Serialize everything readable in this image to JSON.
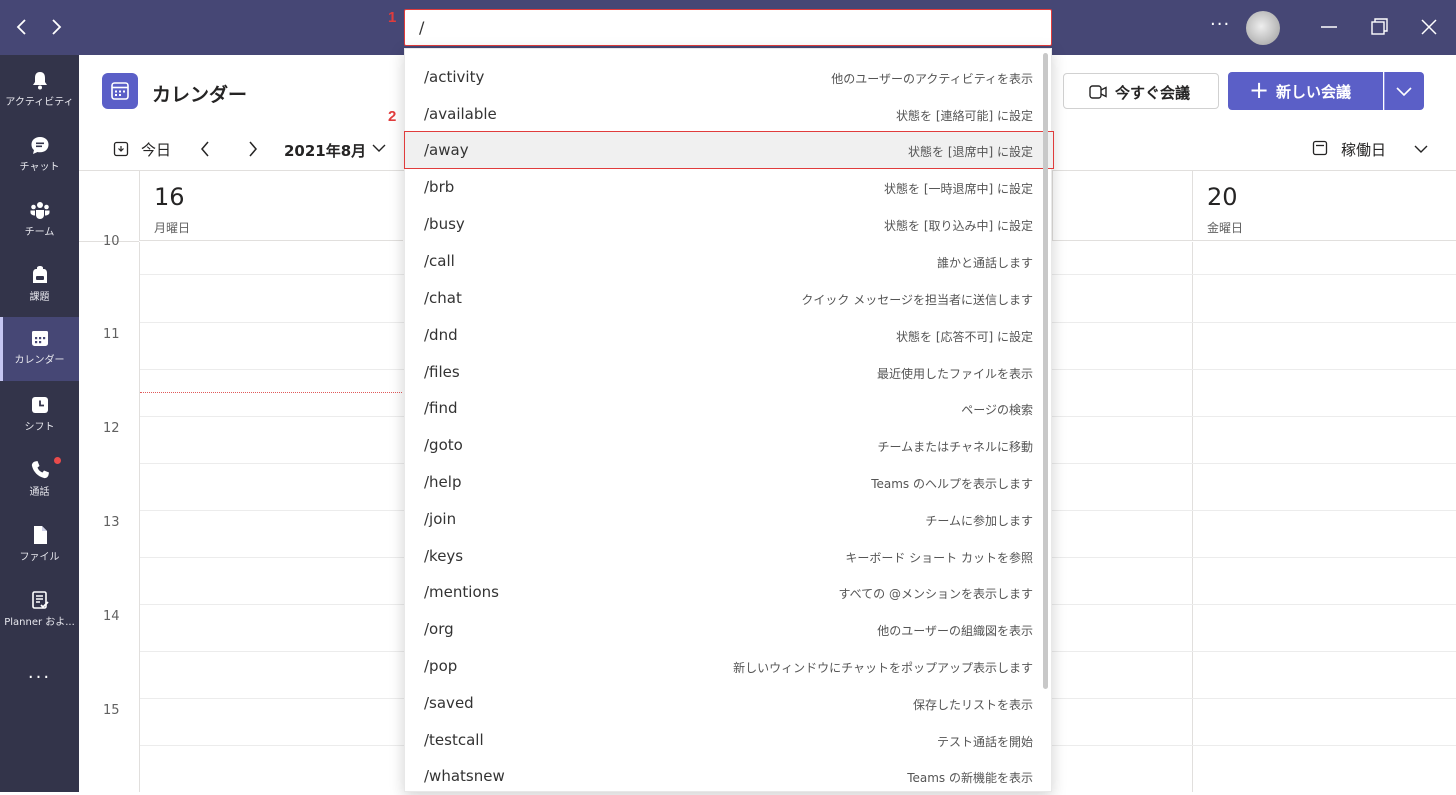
{
  "titlebar": {
    "back_icon": "chevron-left-icon",
    "forward_icon": "chevron-right-icon",
    "search_value": "/",
    "more_label": "···",
    "annotation_1": "1",
    "annotation_2": "2"
  },
  "rail": {
    "items": [
      {
        "label": "アクティビティ",
        "icon": "bell-icon"
      },
      {
        "label": "チャット",
        "icon": "chat-icon"
      },
      {
        "label": "チーム",
        "icon": "teams-icon"
      },
      {
        "label": "課題",
        "icon": "backpack-icon"
      },
      {
        "label": "カレンダー",
        "icon": "calendar-icon"
      },
      {
        "label": "シフト",
        "icon": "clock-icon"
      },
      {
        "label": "通話",
        "icon": "phone-icon"
      },
      {
        "label": "ファイル",
        "icon": "file-icon"
      },
      {
        "label": "Planner およ...",
        "icon": "planner-icon"
      }
    ],
    "more_label": "···"
  },
  "header": {
    "title": "カレンダー",
    "meet_now_label": "今すぐ会議",
    "new_meeting_label": "新しい会議",
    "plus": "+"
  },
  "toolbar": {
    "today_label": "今日",
    "month_label": "2021年8月",
    "view_label": "稼働日"
  },
  "days": [
    {
      "num": "16",
      "name": "月曜日"
    },
    {
      "num": "20",
      "name": "金曜日"
    }
  ],
  "hours": [
    "10",
    "11",
    "12",
    "13",
    "14",
    "15"
  ],
  "commands": [
    {
      "cmd": "/activity",
      "desc": "他のユーザーのアクティビティを表示"
    },
    {
      "cmd": "/available",
      "desc": "状態を [連絡可能] に設定"
    },
    {
      "cmd": "/away",
      "desc": "状態を [退席中] に設定"
    },
    {
      "cmd": "/brb",
      "desc": "状態を [一時退席中] に設定"
    },
    {
      "cmd": "/busy",
      "desc": "状態を [取り込み中] に設定"
    },
    {
      "cmd": "/call",
      "desc": "誰かと通話します"
    },
    {
      "cmd": "/chat",
      "desc": "クイック メッセージを担当者に送信します"
    },
    {
      "cmd": "/dnd",
      "desc": "状態を [応答不可] に設定"
    },
    {
      "cmd": "/files",
      "desc": "最近使用したファイルを表示"
    },
    {
      "cmd": "/find",
      "desc": "ページの検索"
    },
    {
      "cmd": "/goto",
      "desc": "チームまたはチャネルに移動"
    },
    {
      "cmd": "/help",
      "desc": "Teams のヘルプを表示します"
    },
    {
      "cmd": "/join",
      "desc": "チームに参加します"
    },
    {
      "cmd": "/keys",
      "desc": "キーボード ショート カットを参照"
    },
    {
      "cmd": "/mentions",
      "desc": "すべての @メンションを表示します"
    },
    {
      "cmd": "/org",
      "desc": "他のユーザーの組織図を表示"
    },
    {
      "cmd": "/pop",
      "desc": "新しいウィンドウにチャットをポップアップ表示します"
    },
    {
      "cmd": "/saved",
      "desc": "保存したリストを表示"
    },
    {
      "cmd": "/testcall",
      "desc": "テスト通話を開始"
    },
    {
      "cmd": "/whatsnew",
      "desc": "Teams の新機能を表示"
    }
  ],
  "colors": {
    "titlebar": "#464775",
    "rail": "#33344a",
    "accent": "#5b5fc7",
    "highlight": "#e03c3c"
  }
}
